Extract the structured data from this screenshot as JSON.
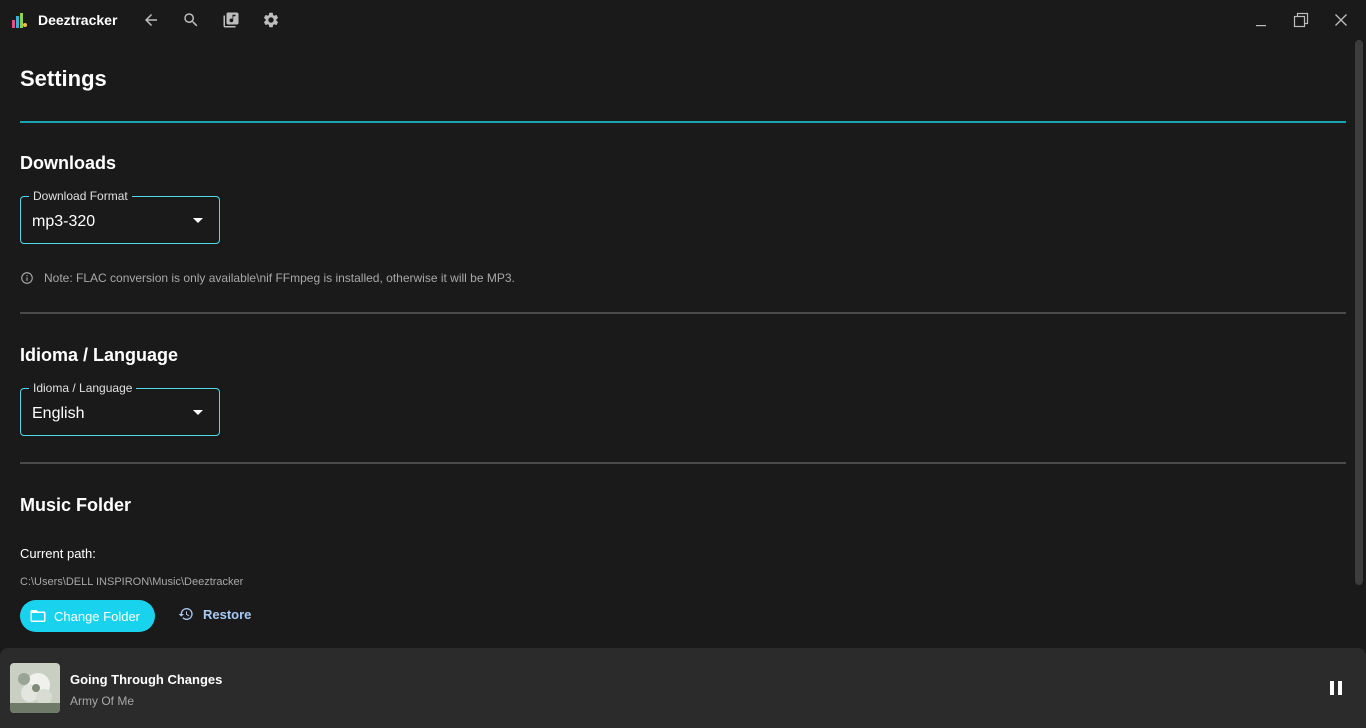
{
  "app": {
    "title": "Deeztracker"
  },
  "page": {
    "title": "Settings"
  },
  "downloads": {
    "heading": "Downloads",
    "format_label": "Download Format",
    "format_value": "mp3-320",
    "note": "Note: FLAC conversion is only available\\nif FFmpeg is installed, otherwise it will be MP3."
  },
  "language": {
    "heading": "Idioma / Language",
    "label": "Idioma / Language",
    "value": "English"
  },
  "music_folder": {
    "heading": "Music Folder",
    "current_path_label": "Current path:",
    "path": "C:\\Users\\DELL INSPIRON\\Music\\Deeztracker",
    "change_button": "Change Folder",
    "restore_button": "Restore"
  },
  "player": {
    "track_title": "Going Through Changes",
    "artist": "Army Of Me"
  },
  "colors": {
    "accent": "#19d3ee",
    "accent_divider": "#1aa3b0",
    "background": "#1a1a1a",
    "player_bg": "#2b2b2b",
    "restore_text": "#a9c9f2"
  }
}
